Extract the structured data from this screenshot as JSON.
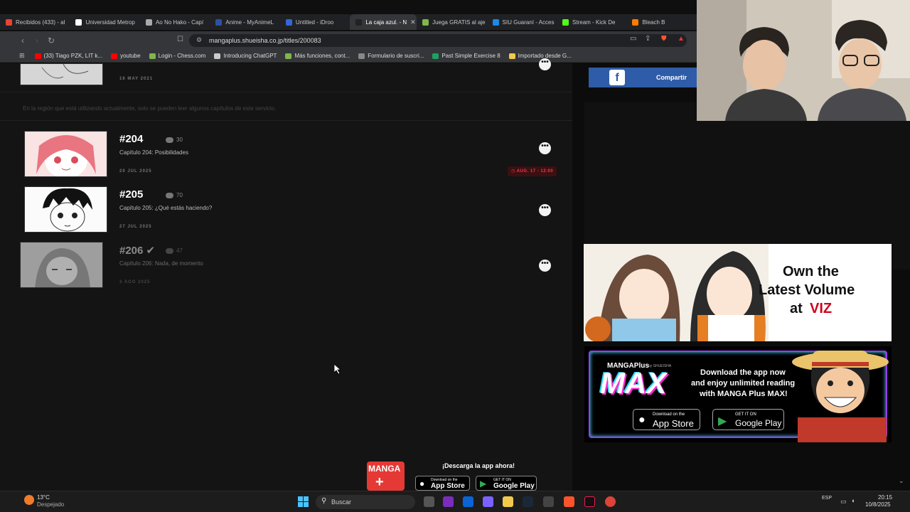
{
  "tabs": [
    {
      "label": "Recibidos (433) - al",
      "color": "#ea4335"
    },
    {
      "label": "Universidad Metrop",
      "color": "#ffffff"
    },
    {
      "label": "Ao No Hako - Capí",
      "color": "#aaaaaa"
    },
    {
      "label": "Anime - MyAnimeL",
      "color": "#2e51a2"
    },
    {
      "label": "Untitled - iDroo",
      "color": "#3367d6"
    },
    {
      "label": "La caja azul. - N",
      "color": "#222222",
      "active": true
    },
    {
      "label": "Juega GRATIS al aje",
      "color": "#81b64c"
    },
    {
      "label": "SIU Guaraní - Acces",
      "color": "#1e88e5"
    },
    {
      "label": "Stream - Kick De",
      "color": "#53fc18"
    },
    {
      "label": "Bleach B",
      "color": "#ff7b00"
    }
  ],
  "browser": {
    "url": "mangaplus.shueisha.co.jp/titles/200083"
  },
  "bookmarks": [
    {
      "label": "(33) Tiago PZK, LIT k...",
      "color": "#ff0000"
    },
    {
      "label": "youtube",
      "color": "#ff0000"
    },
    {
      "label": "Login - Chess.com",
      "color": "#81b64c"
    },
    {
      "label": "Introducing ChatGPT",
      "color": "#cccccc"
    },
    {
      "label": "Más funciones, cont...",
      "color": "#81b64c"
    },
    {
      "label": "Formulario de suscri...",
      "color": "#888888"
    },
    {
      "label": "Past Simple Exercise 8",
      "color": "#1aa260"
    },
    {
      "label": "Importado desde G...",
      "color": "#f2c94c"
    }
  ],
  "page": {
    "top_date": "16 MAY 2021",
    "region_notice": "En la región que está utilizando actualmente, solo se pueden leer algunos capítulos de este servicio.",
    "chapters": [
      {
        "num": "#204",
        "title": "Capítulo 204: Posibilidades",
        "date": "20 JUL 2025",
        "comments": "30",
        "timer": "AUG. 17 - 12:00",
        "dim": false
      },
      {
        "num": "#205",
        "title": "Capítulo 205: ¿Qué estás haciendo?",
        "date": "27 JUL 2025",
        "comments": "70",
        "dim": false
      },
      {
        "num": "#206",
        "title": "Capítulo 206: Nada, de momento",
        "date": "3 AGO 2025",
        "comments": "47",
        "dim": true,
        "read": "✔"
      }
    ],
    "more_glyph": "•••",
    "bottom_banner": {
      "logo": "MANGA",
      "text": "¡Descarga la app ahora!",
      "appstore_small": "Download on the",
      "appstore": "App Store",
      "gplay_small": "GET IT ON",
      "gplay": "Google Play"
    }
  },
  "sidebar": {
    "share_label": "Compartir",
    "fb_glyph": "f",
    "viz": {
      "line1": "Own the",
      "line2": "Latest Volume",
      "line3": "at",
      "brand": "VIZ"
    },
    "max": {
      "brand_small": "MANGAPlus",
      "brand_by": "by SHUEISHA",
      "brand": "MAX",
      "line1": "Download the app now",
      "line2": "and enjoy unlimited reading",
      "line3": "with MANGA Plus MAX!",
      "appstore_small": "Download on the",
      "appstore": "App Store",
      "gplay_small": "GET IT ON",
      "gplay": "Google Play"
    }
  },
  "taskbar": {
    "temp": "13°C",
    "weather": "Despejado",
    "search": "Buscar",
    "lang": "ESP",
    "time": "20:15",
    "date": "10/8/2025"
  }
}
